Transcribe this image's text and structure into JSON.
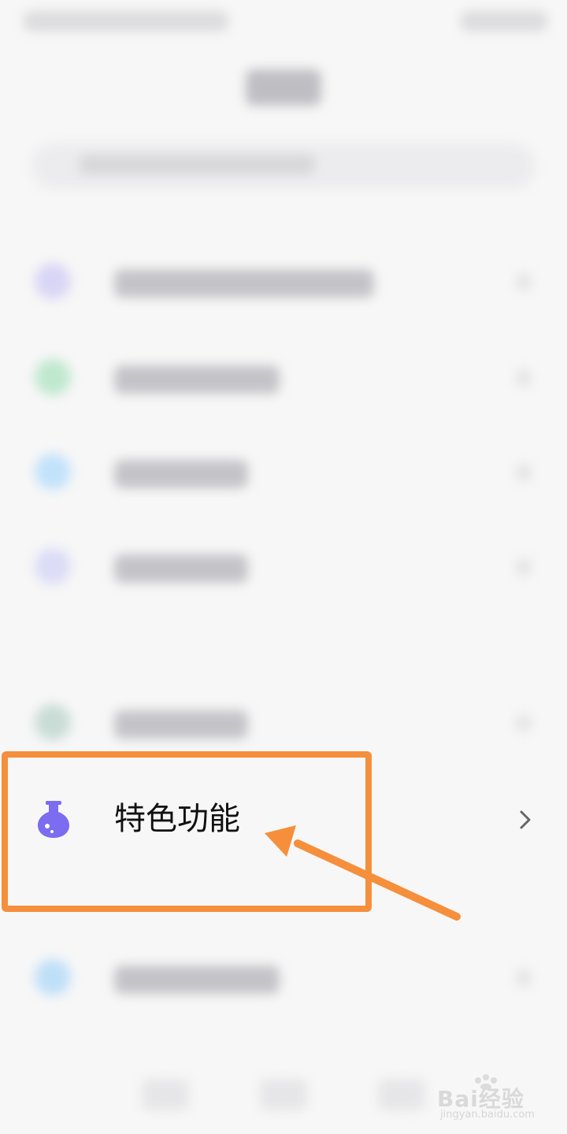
{
  "list": {
    "featured_item": {
      "label": "特色功能",
      "icon": "flask-icon"
    }
  },
  "annotation": {
    "color": "#f58f3c"
  },
  "watermark": {
    "brand": "Bai经验",
    "url": "jingyan.baidu.com"
  },
  "colors": {
    "flask_icon": "#7b6cf0",
    "background": "#f7f7f7"
  }
}
